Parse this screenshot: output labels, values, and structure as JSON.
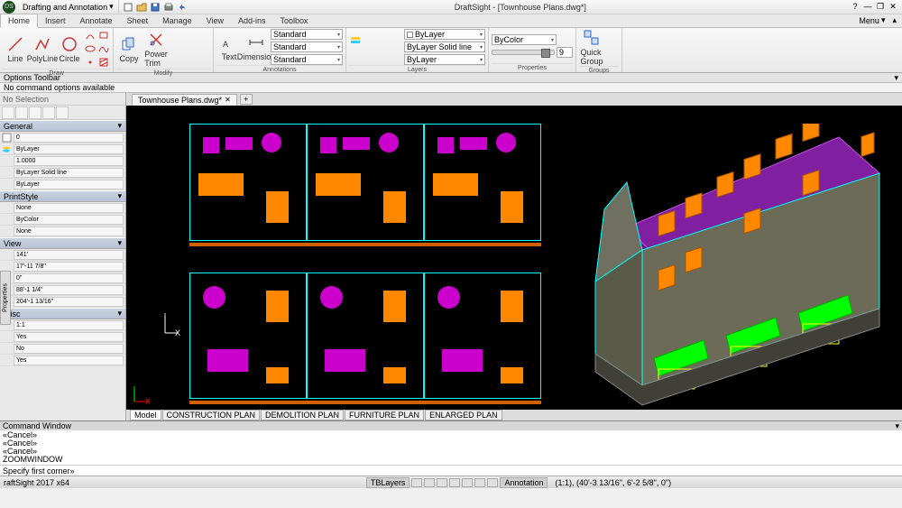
{
  "app": {
    "title": "DraftSight - [Townhouse Plans.dwg*]",
    "workspace": "Drafting and Annotation"
  },
  "window_buttons": {
    "min": "—",
    "max": "❐",
    "close": "✕"
  },
  "menu_right": "Menu",
  "ribbon": {
    "tabs": [
      "Home",
      "Insert",
      "Annotate",
      "Sheet",
      "Manage",
      "View",
      "Add-ins",
      "Toolbox"
    ],
    "active": "Home",
    "groups": {
      "draw": {
        "label": "Draw",
        "big": [
          {
            "name": "line",
            "label": "Line"
          },
          {
            "name": "polyline",
            "label": "PolyLine"
          },
          {
            "name": "circle",
            "label": "Circle"
          }
        ]
      },
      "modify": {
        "label": "Modify",
        "big": [
          {
            "name": "copy",
            "label": "Copy"
          },
          {
            "name": "power-trim",
            "label": "Power\nTrim"
          }
        ]
      },
      "annotations": {
        "label": "Annotations",
        "big": [
          {
            "name": "text",
            "label": "Text"
          },
          {
            "name": "dimension",
            "label": "Dimension"
          }
        ],
        "combos": [
          "Standard",
          "Standard",
          "Standard"
        ]
      },
      "layers": {
        "label": "Layers",
        "combos": [
          "ByLayer",
          "ByLayer  Solid line",
          "ByLayer"
        ]
      },
      "properties": {
        "label": "Properties",
        "combos": [
          "ByColor",
          "",
          "9"
        ]
      },
      "quick_group": {
        "label": "Quick\nGroup"
      },
      "groups_label": "Groups"
    }
  },
  "options_bar": {
    "title": "Options Toolbar",
    "text": "No command options available"
  },
  "properties_panel": {
    "title_tab": "Properties",
    "selection": "No Selection",
    "sections": {
      "general": {
        "label": "General",
        "rows": [
          {
            "icon": "color",
            "value": "0"
          },
          {
            "icon": "layer",
            "value": "ByLayer"
          },
          {
            "icon": "scale",
            "value": "1.0000"
          },
          {
            "icon": "ltype",
            "value": "ByLayer  Solid line"
          },
          {
            "icon": "lweight",
            "value": "ByLayer"
          }
        ]
      },
      "printstyle": {
        "label": "PrintStyle",
        "rows": [
          {
            "icon": "pstyle",
            "value": "None"
          },
          {
            "icon": "pcolor",
            "value": "ByColor"
          },
          {
            "icon": "ptable",
            "value": "None"
          }
        ]
      },
      "view": {
        "label": "View",
        "rows": [
          {
            "icon": "cx",
            "value": "141'"
          },
          {
            "icon": "cy",
            "value": "17'-11 7/8\""
          },
          {
            "icon": "cz",
            "value": "0\""
          },
          {
            "icon": "h",
            "value": "88'-1 1/4\""
          },
          {
            "icon": "w",
            "value": "204'-1 13/16\""
          }
        ]
      },
      "misc": {
        "label": "Misc",
        "rows": [
          {
            "icon": "asc",
            "value": "1:1"
          },
          {
            "icon": "a1",
            "value": "Yes"
          },
          {
            "icon": "a2",
            "value": "No"
          },
          {
            "icon": "a3",
            "value": "Yes"
          }
        ]
      }
    }
  },
  "document": {
    "tab": "Townhouse Plans.dwg*",
    "layouts": [
      "Model",
      "CONSTRUCTION PLAN",
      "DEMOLITION PLAN",
      "FURNITURE PLAN",
      "ENLARGED PLAN"
    ],
    "active_layout": "Model"
  },
  "command": {
    "header": "Command Window",
    "log": [
      "«Cancel»",
      "«Cancel»",
      "«Cancel»",
      "ZOOMWINDOW"
    ],
    "prompt": "Specify first corner»"
  },
  "statusbar": {
    "left": "raftSight 2017 x64",
    "layer_combo": "TBLayers",
    "coords": "(1:1), (40'-3 13/16\", 6'-2 5/8\", 0\")",
    "anno": "Annotation"
  },
  "icons": {
    "chevron": "▾",
    "chevup": "▴",
    "plus": "+",
    "x": "✕"
  }
}
